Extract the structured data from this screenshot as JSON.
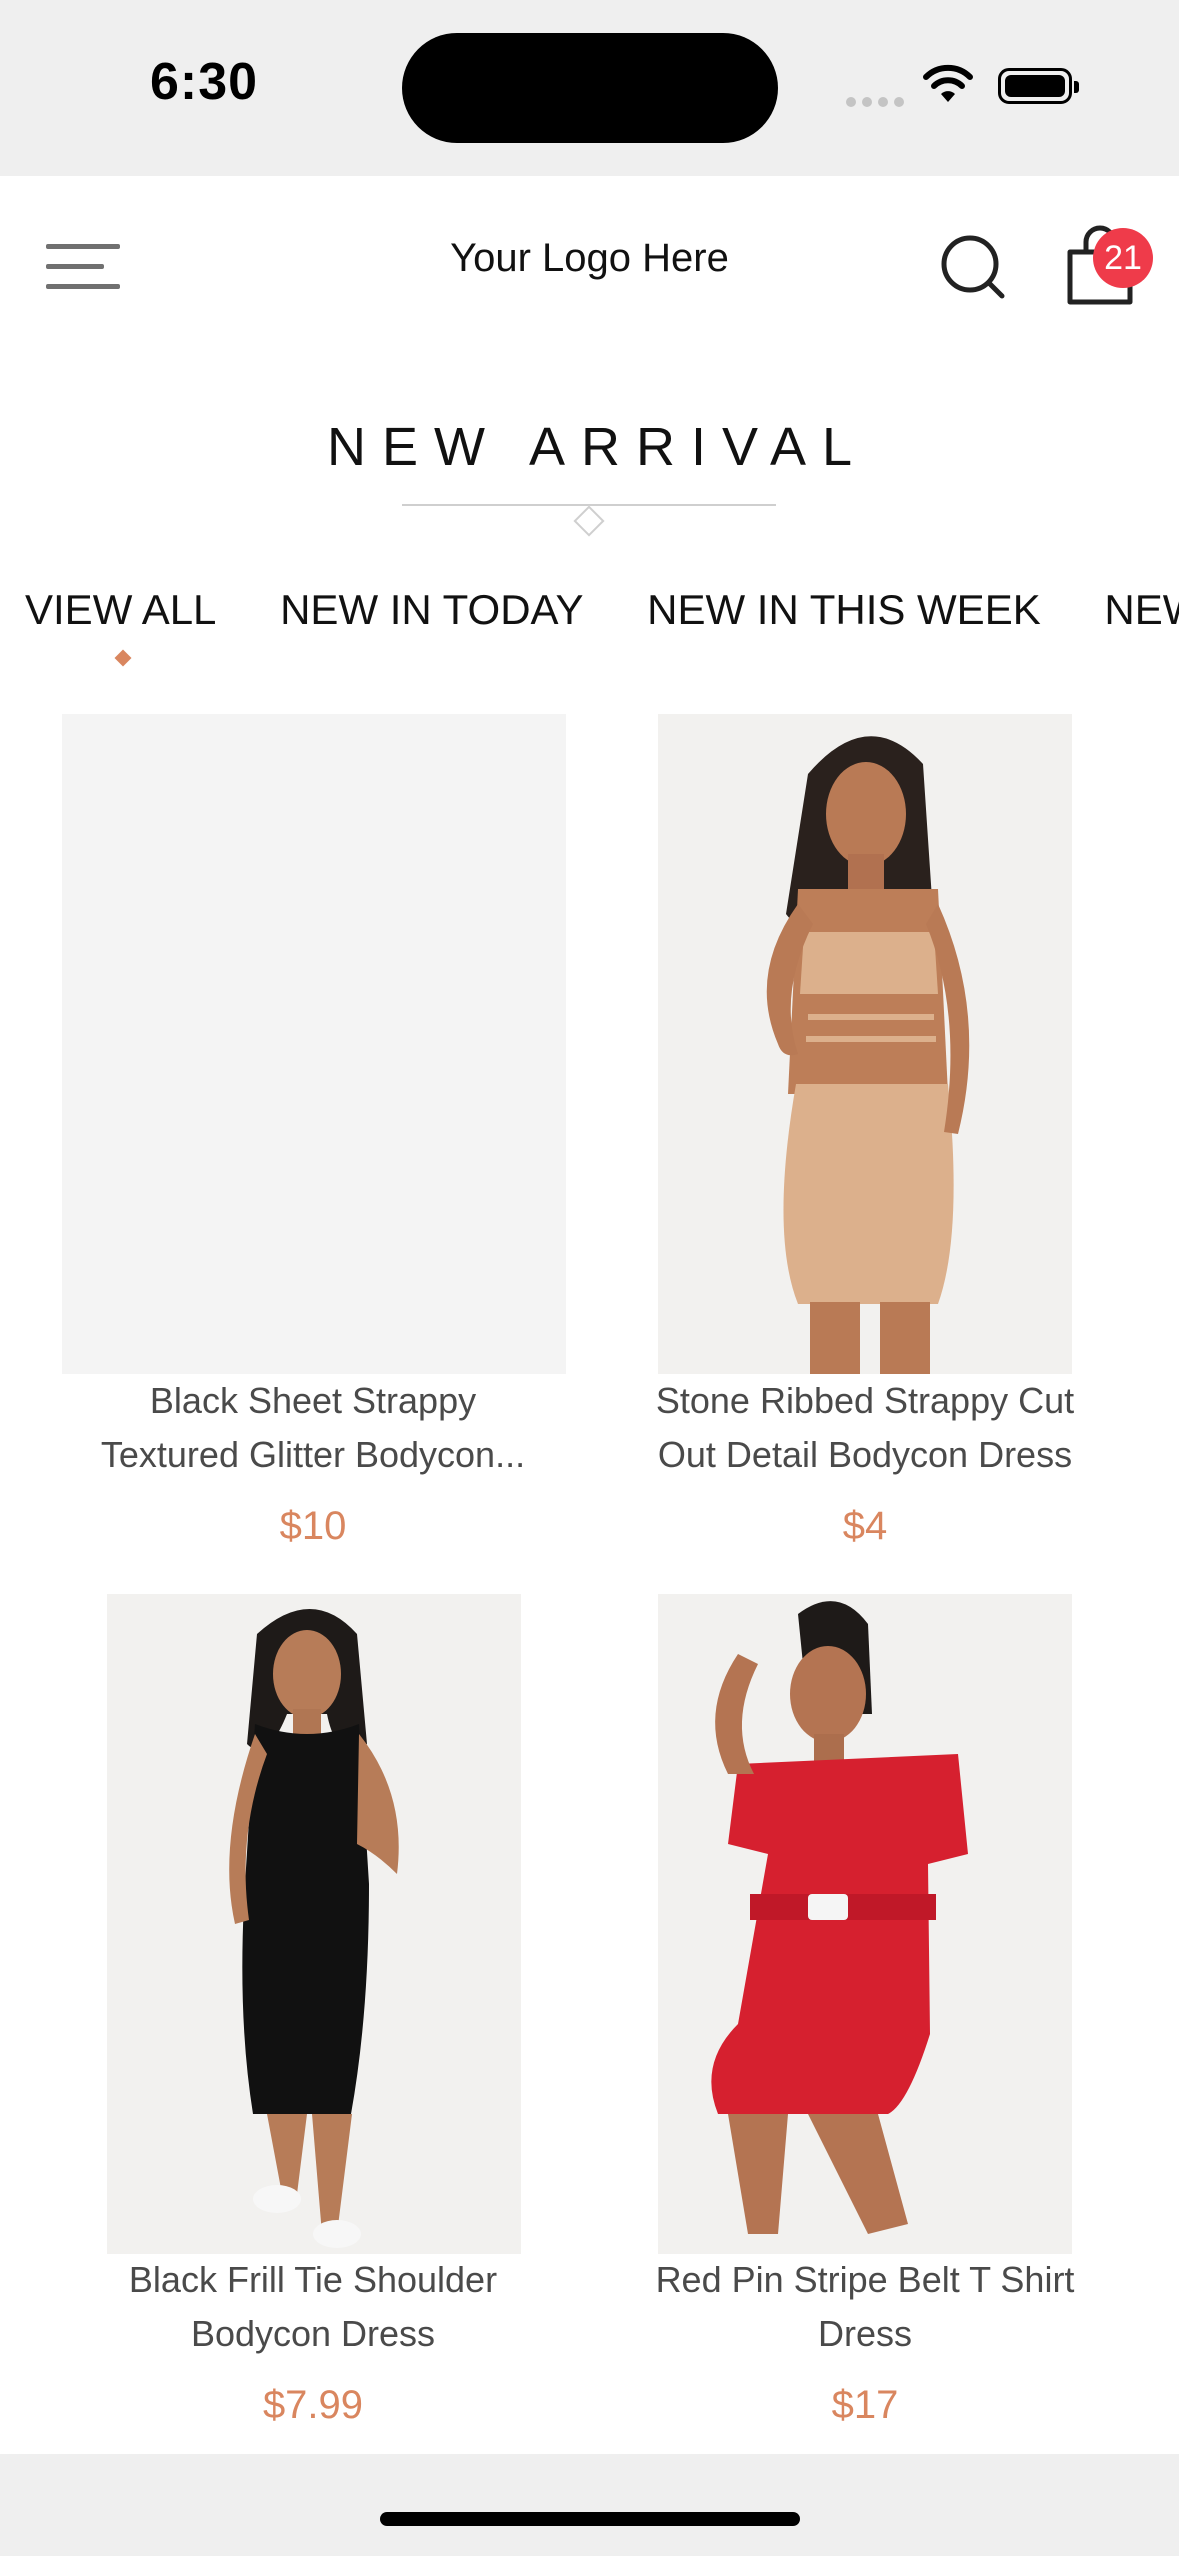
{
  "status_bar": {
    "time": "6:30"
  },
  "header": {
    "logo": "Your Logo Here",
    "cart_count": "21"
  },
  "section": {
    "title": "NEW ARRIVAL"
  },
  "tabs": [
    "VIEW ALL",
    "NEW IN TODAY",
    "NEW IN THIS WEEK",
    "NEW"
  ],
  "active_tab": "VIEW ALL",
  "products": [
    {
      "name_line1": "Black Sheet Strappy",
      "name_line2": "Textured Glitter Bodycon...",
      "price": "$10",
      "image": "blank"
    },
    {
      "name_line1": "Stone Ribbed Strappy Cut",
      "name_line2": "Out Detail Bodycon Dress",
      "price": "$4",
      "image": "model-beige-set"
    },
    {
      "name_line1": "Black Frill Tie Shoulder",
      "name_line2": "Bodycon Dress",
      "price": "$7.99",
      "image": "model-black-dress"
    },
    {
      "name_line1": "Red Pin Stripe Belt T Shirt",
      "name_line2": "Dress",
      "price": "$17",
      "image": "model-red-dress"
    }
  ],
  "colors": {
    "accent": "#d9865f",
    "badge": "#ef3b4a"
  },
  "icons": [
    "menu-icon",
    "search-icon",
    "shopping-bag-icon",
    "wifi-icon",
    "battery-icon"
  ]
}
